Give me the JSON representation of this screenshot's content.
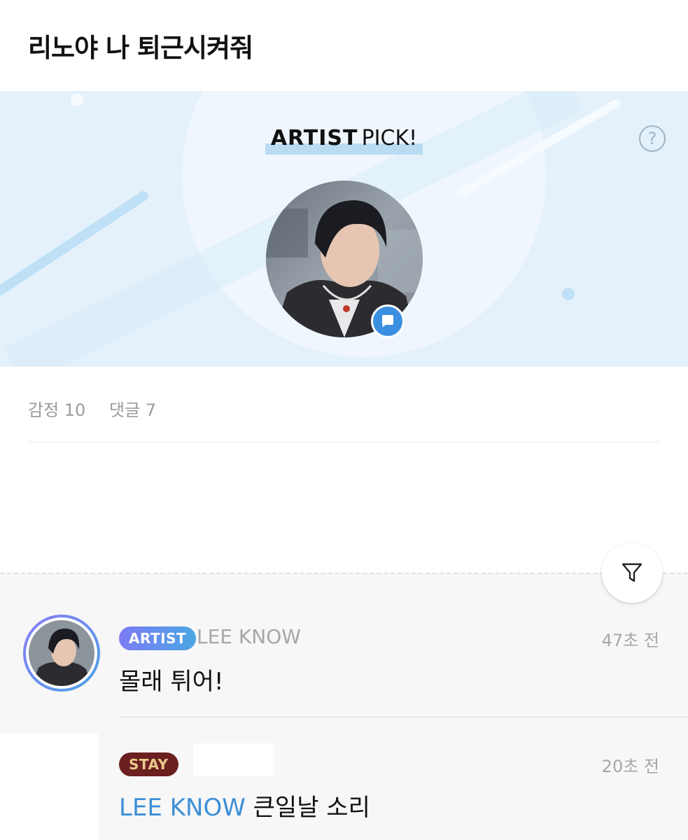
{
  "post": {
    "title": "리노야 나 퇴근시켜줘"
  },
  "artist_pick": {
    "label_bold": "ARTIST",
    "label_regular": "PICK!",
    "help_icon": "question-circle-icon",
    "help_glyph": "?",
    "chat_badge_icon": "chat-bubble-icon"
  },
  "stats": {
    "emotions": "감정 10",
    "comments": "댓글 7"
  },
  "filter": {
    "icon": "filter-funnel-icon"
  },
  "comments": [
    {
      "badge": "ARTIST",
      "author": "LEE KNOW",
      "time": "47초 전",
      "text": "몰래 튀어!"
    },
    {
      "badge": "STAY",
      "author": "",
      "time": "20초 전",
      "mention": "LEE KNOW",
      "text": " 큰일날 소리"
    }
  ],
  "colors": {
    "banner_bg": "#e4f1fb",
    "accent_blue": "#3b8fe0",
    "artist_badge_start": "#7d7bf4",
    "artist_badge_end": "#4aa6e4",
    "stay_badge_bg": "#6b1f1f",
    "stay_badge_text": "#e9c98a",
    "mention": "#3d8fd6"
  }
}
